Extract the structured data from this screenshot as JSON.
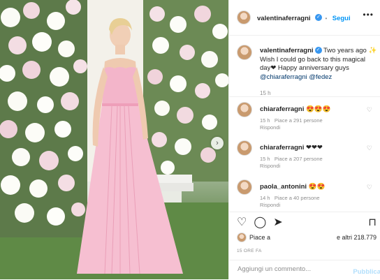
{
  "header": {
    "username": "valentinaferragni",
    "follow_label": "Segui",
    "separator": "•",
    "more_icon": "more-dots-icon"
  },
  "caption": {
    "username": "valentinaferragni",
    "text_1": "Two years ago",
    "text_2": "✨ Wish I could go back to this magical day❤ Happy anniversary guys",
    "mention_1": "@chiaraferragni",
    "mention_2": "@fedez",
    "time": "15 h"
  },
  "comments": [
    {
      "username": "chiaraferragni",
      "text": "😍😍😍",
      "time": "15 h",
      "likes": "Piace a 291 persone",
      "reply": "Rispondi"
    },
    {
      "username": "chiaraferragni",
      "text": "❤❤❤",
      "time": "15 h",
      "likes": "Piace a 207 persone",
      "reply": "Rispondi"
    },
    {
      "username": "paola_antonini",
      "text": "😍😍",
      "time": "14 h",
      "likes": "Piace a 40 persone",
      "reply": "Rispondi"
    }
  ],
  "likes_bar": {
    "likes_prefix": "Piace a",
    "likes_suffix": "e altri 218.779"
  },
  "posted": "15 ORE FA",
  "add_comment": {
    "placeholder": "Aggiungi un commento...",
    "publish_label": "Pubblica"
  },
  "colors": {
    "accent": "#0095f6",
    "verified": "#3897f0",
    "dress": "#f4b8cd"
  }
}
